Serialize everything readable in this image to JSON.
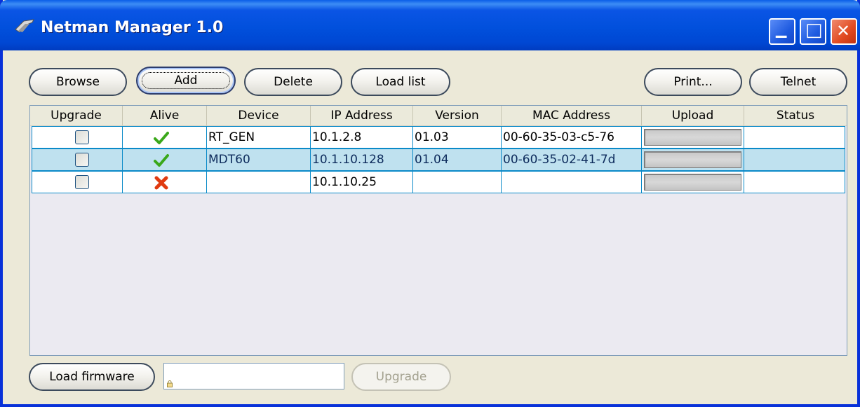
{
  "window": {
    "title": "Netman Manager 1.0",
    "minimize_glyph": "▁",
    "maximize_glyph": "□",
    "close_glyph": "✕"
  },
  "toolbar": {
    "browse": "Browse",
    "add": "Add",
    "delete": "Delete",
    "load_list": "Load list",
    "print": "Print...",
    "telnet": "Telnet"
  },
  "table": {
    "columns": [
      "Upgrade",
      "Alive",
      "Device",
      "IP Address",
      "Version",
      "MAC Address",
      "Upload",
      "Status"
    ],
    "rows": [
      {
        "upgrade": false,
        "alive": "check-icon",
        "device": "RT_GEN",
        "ip": "10.1.2.8",
        "version": "01.03",
        "mac": "00-60-35-03-c5-76",
        "status": "",
        "selected": false
      },
      {
        "upgrade": false,
        "alive": "check-icon",
        "device": "MDT60",
        "ip": "10.1.10.128",
        "version": "01.04",
        "mac": "00-60-35-02-41-7d",
        "status": "",
        "selected": true
      },
      {
        "upgrade": false,
        "alive": "cross-icon",
        "device": "",
        "ip": "10.1.10.25",
        "version": "",
        "mac": "",
        "status": "",
        "selected": false
      }
    ]
  },
  "footer": {
    "load_firmware": "Load firmware",
    "firmware_path": "",
    "upgrade": "Upgrade"
  },
  "colors": {
    "titlebar": "#0150dc",
    "selected_row": "#bfe1ef",
    "grid_line": "#0a8ac8",
    "ok": "#3aa81a",
    "error": "#e03a10"
  }
}
